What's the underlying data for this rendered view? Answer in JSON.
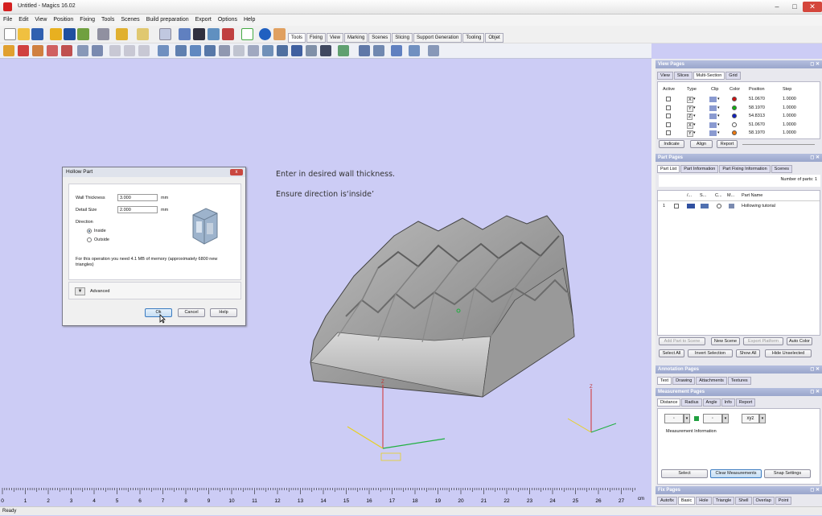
{
  "window": {
    "title": "Untitled - Magics 16.02",
    "min": "–",
    "max": "□",
    "close": "✕"
  },
  "menu": [
    "File",
    "Edit",
    "View",
    "Position",
    "Fixing",
    "Tools",
    "Scenes",
    "Build preparation",
    "Export",
    "Options",
    "Help"
  ],
  "toolbar_tabs": [
    "Tools",
    "Fixing",
    "View",
    "Marking",
    "Scenes",
    "Slicing",
    "Support Generation",
    "Tooling",
    "Objet"
  ],
  "instructions": {
    "line1": "Enter in desired wall thickness.",
    "line2": "Ensure direction is‘inside’"
  },
  "dialog": {
    "title": "Hollow Part",
    "close": "x",
    "wall_thickness": {
      "label": "Wall Thickness",
      "value": "3.000",
      "unit": "mm"
    },
    "detail_size": {
      "label": "Detail Size",
      "value": "2.000",
      "unit": "mm"
    },
    "direction": {
      "label": "Direction",
      "options": [
        "Inside",
        "Outside"
      ],
      "selected": "Inside"
    },
    "memory_note": "For this operation you need 4.1 MB of memory (approximately 6800 new triangles)",
    "advanced_label": "Advanced",
    "ok": "Ok",
    "cancel": "Cancel",
    "help": "Help"
  },
  "axis_labels": {
    "z": "Z",
    "x": "X"
  },
  "ruler": {
    "ticks": [
      "0",
      "1",
      "2",
      "3",
      "4",
      "5",
      "6",
      "7",
      "8",
      "9",
      "10",
      "11",
      "12",
      "13",
      "14",
      "15",
      "16",
      "17",
      "18",
      "19",
      "20",
      "21",
      "22",
      "23",
      "24",
      "25",
      "26",
      "27"
    ],
    "unit": "cm"
  },
  "status": "Ready",
  "view_pages": {
    "title": "View Pages",
    "tabs": [
      "View",
      "Slices",
      "Multi-Section",
      "Grid"
    ],
    "active_tab": "Multi-Section",
    "columns": [
      "Active",
      "Type",
      "Clip",
      "Color",
      "Position",
      "Step"
    ],
    "rows": [
      {
        "type": "X",
        "color": "#d01010",
        "position": "51.0670",
        "step": "1.0000"
      },
      {
        "type": "Y",
        "color": "#10b010",
        "position": "58.1970",
        "step": "1.0000"
      },
      {
        "type": "Z",
        "color": "#1020c0",
        "position": "54.8313",
        "step": "1.0000"
      },
      {
        "type": "X",
        "color": "#ffffff",
        "position": "51.0670",
        "step": "1.0000"
      },
      {
        "type": "Y",
        "color": "#f07a10",
        "position": "58.1970",
        "step": "1.0000"
      }
    ],
    "buttons": [
      "Indicate",
      "Align",
      "Report"
    ]
  },
  "part_pages": {
    "title": "Part Pages",
    "tabs": [
      "Part List",
      "Part Information",
      "Part Fixing Information",
      "Scenes"
    ],
    "active_tab": "Part List",
    "parts_count": "Number of parts: 1",
    "columns": [
      "",
      "/...",
      "S...",
      "C...",
      "M...",
      "Part Name"
    ],
    "rows": [
      {
        "index": "1",
        "name": "Hollowing tutorial"
      }
    ],
    "buttons_row1": [
      "Add Part to Scene",
      "New Scene",
      "Export Platform",
      "Auto Color"
    ],
    "buttons_row2": [
      "Select All",
      "Invert Selection",
      "Show All",
      "Hide Unselected"
    ]
  },
  "annotation_pages": {
    "title": "Annotation Pages",
    "tabs": [
      "Text",
      "Drawing",
      "Attachments",
      "Textures"
    ],
    "active_tab": "Text"
  },
  "measurement_pages": {
    "title": "Measurement Pages",
    "tabs": [
      "Distance",
      "Radius",
      "Angle",
      "Info",
      "Report"
    ],
    "active_tab": "Distance",
    "info_label": "Measurement Information",
    "xyz": "xyz",
    "buttons": [
      "Select",
      "Clear Measurements",
      "Snap Settings"
    ]
  },
  "fix_pages": {
    "title": "Fix Pages",
    "tabs": [
      "Autofix",
      "Basic",
      "Hole",
      "Triangle",
      "Shell",
      "Overlap",
      "Point"
    ],
    "active_tab": "Basic"
  },
  "colors": {
    "viewport_bg": "#ccccf5",
    "panel_header": "#9aa6cc",
    "axis_red": "#d23030",
    "axis_yellow": "#e8d020",
    "axis_green": "#20b040"
  }
}
